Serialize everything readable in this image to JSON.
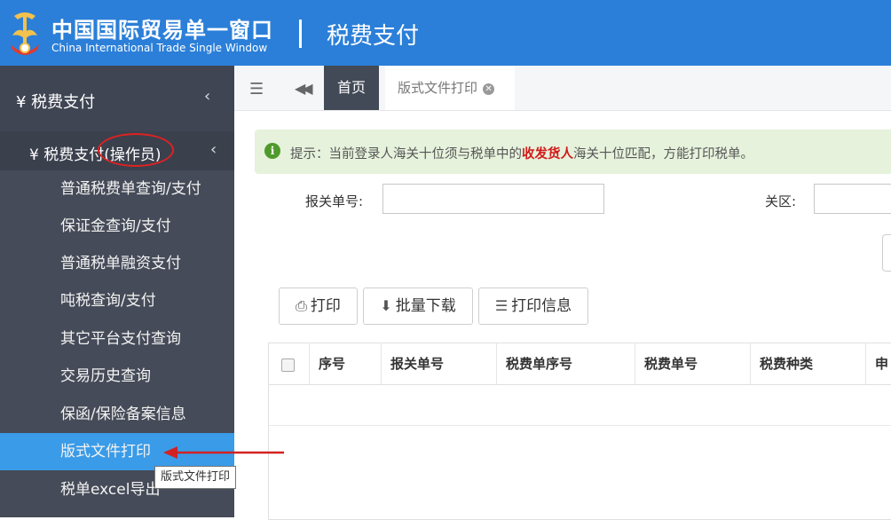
{
  "header": {
    "brand_cn": "中国国际贸易单一窗口",
    "brand_en": "China International Trade Single Window",
    "module_title": "税费支付",
    "logo_icon": "customs-emblem-icon"
  },
  "sidebar": {
    "section": "¥ 税费支付",
    "subsection": "¥ 税费支付(操作员)",
    "items": [
      {
        "label": "普通税费单查询/支付"
      },
      {
        "label": "保证金查询/支付"
      },
      {
        "label": "普通税单融资支付"
      },
      {
        "label": "吨税查询/支付"
      },
      {
        "label": "其它平台支付查询"
      },
      {
        "label": "交易历史查询"
      },
      {
        "label": "保函/保险备案信息"
      },
      {
        "label": "版式文件打印"
      },
      {
        "label": "税单excel导出"
      }
    ],
    "active_item": "版式文件打印",
    "colors": {
      "bg": "#454b58",
      "active": "#3a9be8"
    }
  },
  "tabs": {
    "home": "首页",
    "current": "版式文件打印"
  },
  "notice": {
    "prefix": "提示：当前登录人海关十位须与税单中的",
    "highlight": "收发货人",
    "suffix": "海关十位匹配，方能打印税单。"
  },
  "form": {
    "declaration_label": "报关单号:",
    "declaration_value": "",
    "customs_label": "关区:",
    "customs_value": ""
  },
  "toolbar": {
    "print": "打印",
    "batch_download": "批量下载",
    "print_info": "打印信息"
  },
  "table": {
    "columns": [
      "序号",
      "报关单号",
      "税费单序号",
      "税费单号",
      "税费种类",
      "申"
    ]
  },
  "tooltip": "版式文件打印",
  "colors": {
    "header": "#2b7fd8",
    "highlight": "#d21a1a",
    "annotation": "#d22222"
  }
}
